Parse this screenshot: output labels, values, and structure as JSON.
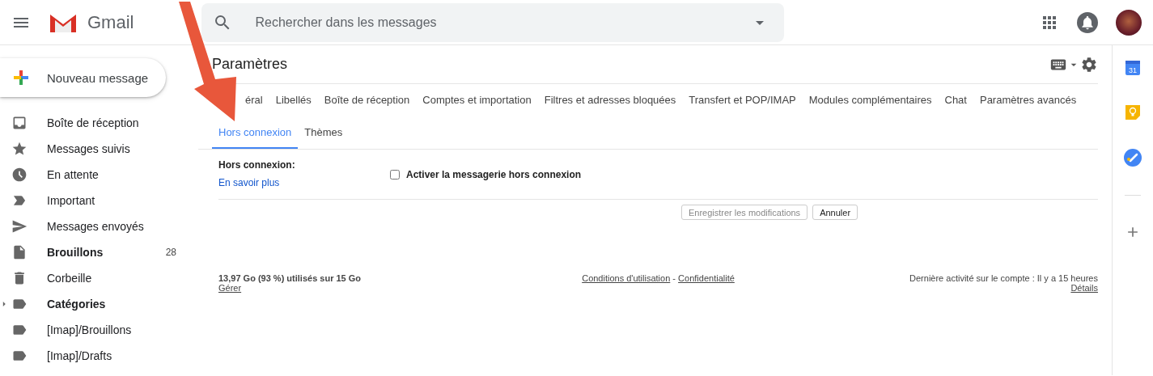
{
  "header": {
    "app_name": "Gmail",
    "search": {
      "placeholder": "Rechercher dans les messages"
    }
  },
  "compose": {
    "label": "Nouveau message"
  },
  "sidebar": {
    "items": [
      {
        "label": "Boîte de réception",
        "bold": false,
        "expandable": false
      },
      {
        "label": "Messages suivis",
        "bold": false,
        "expandable": false
      },
      {
        "label": "En attente",
        "bold": false,
        "expandable": false
      },
      {
        "label": "Important",
        "bold": false,
        "expandable": false
      },
      {
        "label": "Messages envoyés",
        "bold": false,
        "expandable": false
      },
      {
        "label": "Brouillons",
        "bold": true,
        "count": "28",
        "expandable": false
      },
      {
        "label": "Corbeille",
        "bold": false,
        "expandable": false
      },
      {
        "label": "Catégories",
        "bold": true,
        "expandable": true
      },
      {
        "label": "[Imap]/Brouillons",
        "bold": false,
        "expandable": false
      },
      {
        "label": "[Imap]/Drafts",
        "bold": false,
        "expandable": false
      }
    ]
  },
  "settings": {
    "title": "Paramètres",
    "tab_rows": [
      [
        {
          "label": "éral",
          "selected": false
        },
        {
          "label": "Libellés",
          "selected": false
        },
        {
          "label": "Boîte de réception",
          "selected": false
        },
        {
          "label": "Comptes et importation",
          "selected": false
        },
        {
          "label": "Filtres et adresses bloquées",
          "selected": false
        },
        {
          "label": "Transfert et POP/IMAP",
          "selected": false
        },
        {
          "label": "Modules complémentaires",
          "selected": false
        },
        {
          "label": "Chat",
          "selected": false
        },
        {
          "label": "Paramètres avancés",
          "selected": false
        }
      ],
      [
        {
          "label": "Hors connexion",
          "selected": true
        },
        {
          "label": "Thèmes",
          "selected": false
        }
      ]
    ],
    "section": {
      "label": "Hors connexion:",
      "link": "En savoir plus",
      "option": {
        "label": "Activer la messagerie hors connexion",
        "checked": false
      }
    },
    "buttons": [
      {
        "label": "Enregistrer les modifications",
        "disabled": true
      },
      {
        "label": "Annuler",
        "disabled": false
      }
    ]
  },
  "footer": {
    "storage": "13,97 Go (93 %) utilisés sur 15 Go",
    "manage": "Gérer",
    "terms": "Conditions d'utilisation",
    "separator": "-",
    "privacy": "Confidentialité",
    "activity": "Dernière activité sur le compte : Il y a 15 heures",
    "details": "Détails"
  },
  "rail": {
    "calendar_day": "31"
  }
}
